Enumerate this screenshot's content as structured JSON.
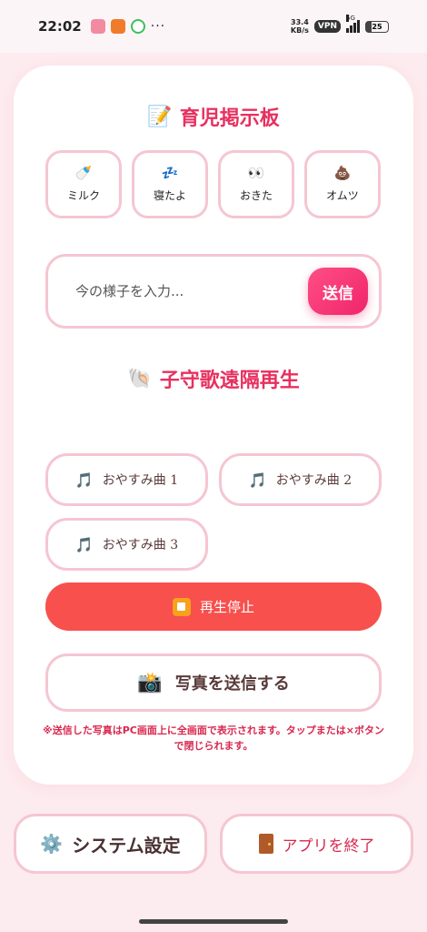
{
  "status_bar": {
    "time": "22:02",
    "dots": "···",
    "net_speed_value": "33.4",
    "net_speed_unit": "KB/s",
    "vpn": "VPN",
    "network": "5G",
    "battery": "25"
  },
  "board": {
    "title": "育児掲示板",
    "title_icon": "memo-icon",
    "quick_buttons": [
      {
        "emoji": "🍼",
        "label": "ミルク",
        "icon": "baby-bottle-icon"
      },
      {
        "emoji": "💤",
        "label": "寝たよ",
        "icon": "sleep-icon"
      },
      {
        "emoji": "👀",
        "label": "おきた",
        "icon": "eyes-icon"
      },
      {
        "emoji": "💩",
        "label": "オムツ",
        "icon": "poop-icon"
      }
    ],
    "input_placeholder": "今の様子を入力...",
    "send_label": "送信"
  },
  "lullaby": {
    "title": "子守歌遠隔再生",
    "title_icon": "shell-icon",
    "songs": [
      "おやすみ曲 1",
      "おやすみ曲 2",
      "おやすみ曲 3"
    ],
    "stop_label": "再生停止"
  },
  "photo": {
    "button_label": "写真を送信する",
    "note": "※送信した写真はPC画面上に全画面で表示されます。タップまたは×ボタンで閉じられます。"
  },
  "footer": {
    "system_label": "システム設定",
    "exit_label": "アプリを終了"
  },
  "colors": {
    "accent": "#e8305f",
    "border": "#f5c6d2",
    "stop": "#f7504d",
    "background": "#fdecef"
  }
}
